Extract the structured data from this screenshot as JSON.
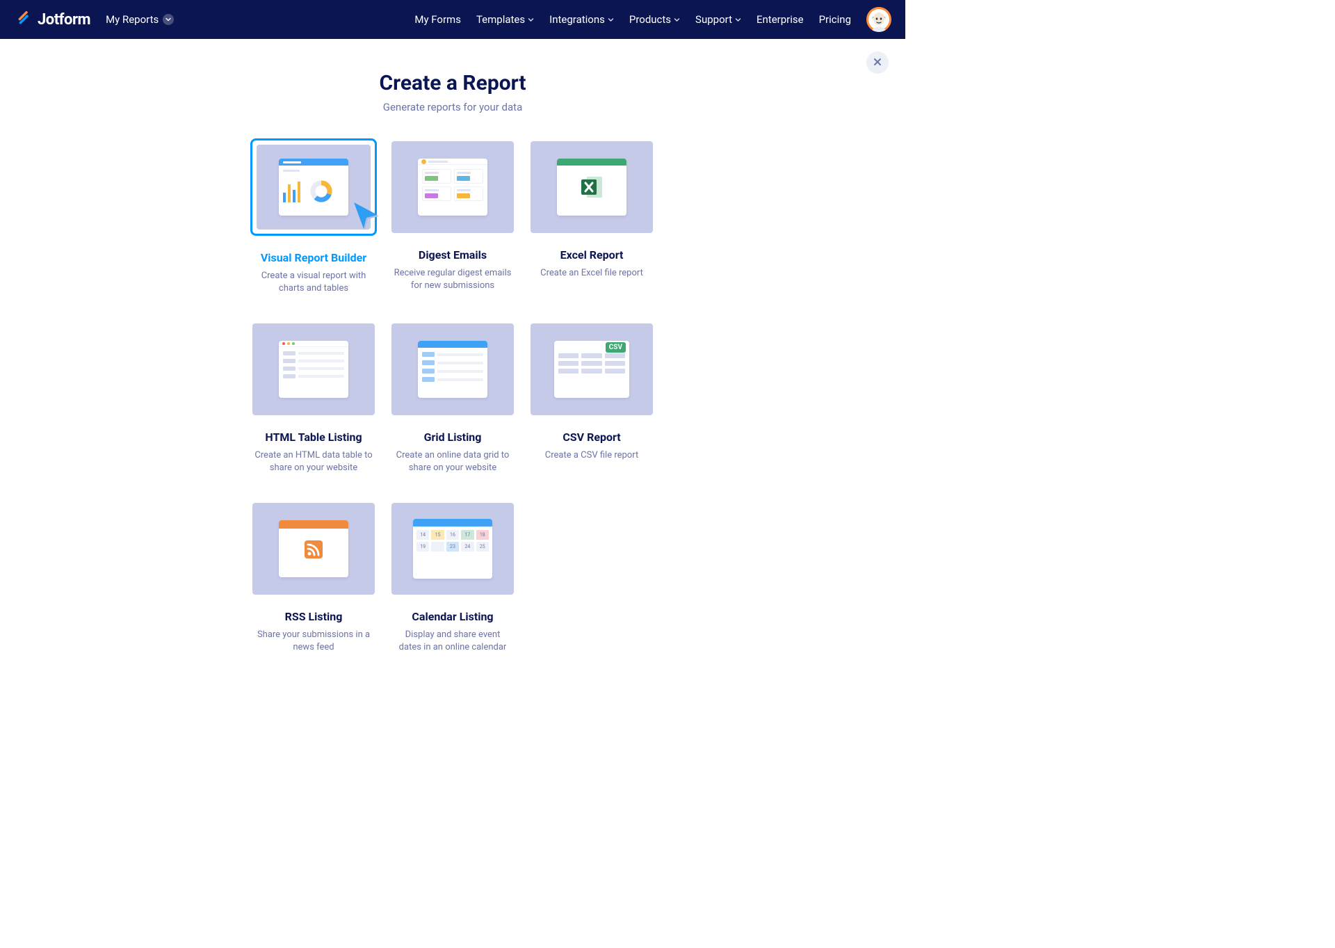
{
  "header": {
    "brand": "Jotform",
    "context_label": "My Reports",
    "nav": [
      {
        "label": "My Forms",
        "has_chevron": false
      },
      {
        "label": "Templates",
        "has_chevron": true
      },
      {
        "label": "Integrations",
        "has_chevron": true
      },
      {
        "label": "Products",
        "has_chevron": true
      },
      {
        "label": "Support",
        "has_chevron": true
      },
      {
        "label": "Enterprise",
        "has_chevron": false
      },
      {
        "label": "Pricing",
        "has_chevron": false
      }
    ]
  },
  "page": {
    "title": "Create a Report",
    "subtitle": "Generate reports for your data"
  },
  "cards": [
    {
      "id": "visual-report-builder",
      "title": "Visual Report Builder",
      "desc": "Create a visual report with charts and tables",
      "selected": true
    },
    {
      "id": "digest-emails",
      "title": "Digest Emails",
      "desc": "Receive regular digest emails for new submissions",
      "selected": false
    },
    {
      "id": "excel-report",
      "title": "Excel Report",
      "desc": "Create an Excel file report",
      "selected": false
    },
    {
      "id": "html-table-listing",
      "title": "HTML Table Listing",
      "desc": "Create an HTML data table to share on your website",
      "selected": false
    },
    {
      "id": "grid-listing",
      "title": "Grid Listing",
      "desc": "Create an online data grid to share on your website",
      "selected": false
    },
    {
      "id": "csv-report",
      "title": "CSV Report",
      "desc": "Create a CSV file report",
      "selected": false
    },
    {
      "id": "rss-listing",
      "title": "RSS Listing",
      "desc": "Share your submissions in a news feed",
      "selected": false
    },
    {
      "id": "calendar-listing",
      "title": "Calendar Listing",
      "desc": "Display and share event dates in an online calendar",
      "selected": false
    }
  ],
  "calendar_cells": [
    "14",
    "15",
    "16",
    "17",
    "18",
    "19",
    "",
    "23",
    "24",
    "25"
  ]
}
